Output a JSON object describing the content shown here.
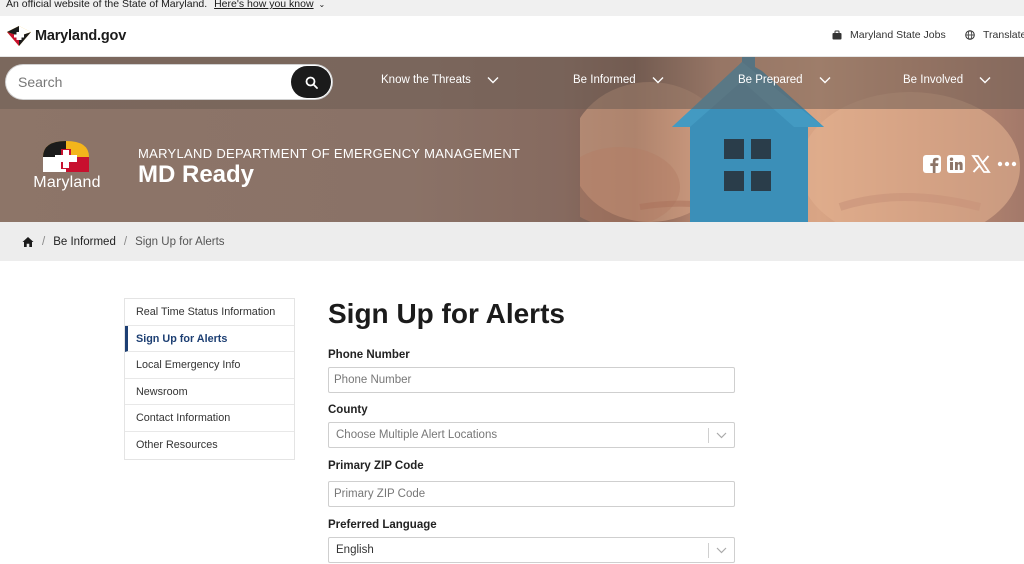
{
  "banner": {
    "text": "An official website of the State of Maryland.",
    "how_link": "Here's how you know"
  },
  "utility": {
    "logo_text": "Maryland.gov",
    "jobs_label": "Maryland State Jobs",
    "translate_label": "Translate"
  },
  "search": {
    "placeholder": "Search"
  },
  "nav": {
    "items": [
      {
        "label": "Know the Threats"
      },
      {
        "label": "Be Informed"
      },
      {
        "label": "Be Prepared"
      },
      {
        "label": "Be Involved"
      }
    ]
  },
  "header": {
    "logo_text": "Maryland",
    "department": "MARYLAND DEPARTMENT OF EMERGENCY MANAGEMENT",
    "site_name": "MD Ready",
    "social": [
      "facebook-icon",
      "linkedin-icon",
      "x-icon",
      "more-icon"
    ]
  },
  "breadcrumb": {
    "items": [
      {
        "label": "Be Informed"
      },
      {
        "label": "Sign Up for Alerts"
      }
    ]
  },
  "sidebar": {
    "items": [
      {
        "label": "Real Time Status Information"
      },
      {
        "label": "Sign Up for Alerts",
        "active": true
      },
      {
        "label": "Local Emergency Info"
      },
      {
        "label": "Newsroom"
      },
      {
        "label": "Contact Information"
      },
      {
        "label": "Other Resources"
      }
    ]
  },
  "form": {
    "title": "Sign Up for Alerts",
    "phone": {
      "label": "Phone Number",
      "placeholder": "Phone Number",
      "value": ""
    },
    "county": {
      "label": "County",
      "placeholder": "Choose Multiple Alert Locations"
    },
    "zip": {
      "label": "Primary ZIP Code",
      "placeholder": "Primary ZIP Code",
      "value": ""
    },
    "language": {
      "label": "Preferred Language",
      "value": "English"
    }
  },
  "colors": {
    "active_nav": "#1d3f73",
    "md_red": "#c8102e",
    "md_gold": "#f3b51b",
    "house_blue": "#3b8fb8"
  }
}
